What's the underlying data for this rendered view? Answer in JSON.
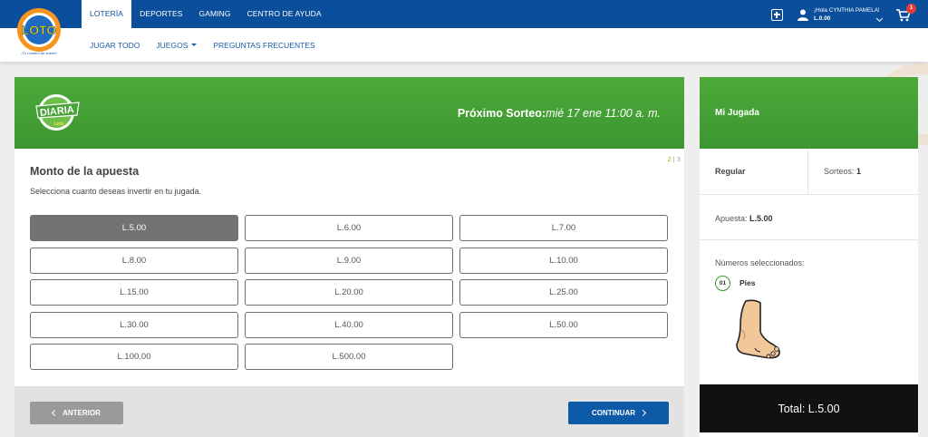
{
  "header": {
    "logo_text": "LOTO",
    "logo_tagline": "¡Tu número de suerte!",
    "nav": [
      "LOTERÍA",
      "DEPORTES",
      "GAMING",
      "CENTRO DE AYUDA"
    ],
    "subnav": [
      "JUGAR TODO",
      "JUEGOS",
      "PREGUNTAS FRECUENTES"
    ],
    "greeting": "¡Hola CYNTHIA PAMELA!",
    "balance": "L.0.00",
    "cart_count": "1",
    "icons": [
      "add-square-icon",
      "user-icon",
      "chevron-down-icon",
      "cart-icon"
    ]
  },
  "banner": {
    "logo_text": "DIARIA",
    "logo_sub": "Loto",
    "draw_label": "Próximo Sorteo:",
    "draw_date": "mié 17 ene 11:00 a. m."
  },
  "step": {
    "current": "2",
    "separator": "|",
    "total": "3"
  },
  "amount": {
    "title": "Monto de la apuesta",
    "subtitle": "Selecciona cuanto deseas invertir en tu jugada.",
    "options": [
      "L.5.00",
      "L.6.00",
      "L.7.00",
      "L.8.00",
      "L.9.00",
      "L.10.00",
      "L.15.00",
      "L.20.00",
      "L.25.00",
      "L.30.00",
      "L.40.00",
      "L.50.00",
      "L.100.00",
      "L.500.00"
    ],
    "selected": "L.5.00"
  },
  "buttons": {
    "prev": "ANTERIOR",
    "next": "CONTINUAR"
  },
  "sidebar": {
    "title": "Mi Jugada",
    "type": "Regular",
    "draws_label": "Sorteos:",
    "draws_value": "1",
    "bet_label": "Apuesta:",
    "bet_value": "L.5.00",
    "numbers_label": "Números seleccionados:",
    "number": "01",
    "number_name": "Pies",
    "total": "Total: L.5.00"
  },
  "colors": {
    "header_blue": "#0b4f9c",
    "banner_green": "#3c9630",
    "selected_gray": "#727272",
    "continue_blue": "#0d5aa7",
    "total_black": "#111111"
  }
}
